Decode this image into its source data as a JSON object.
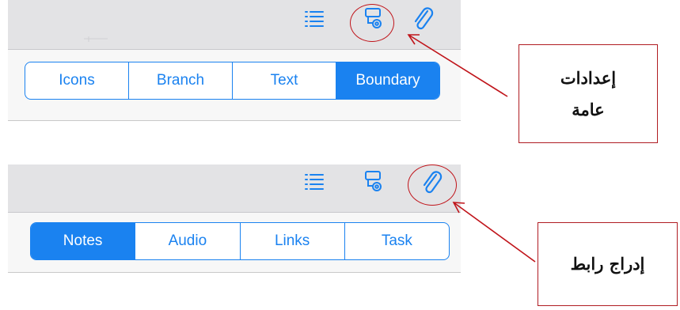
{
  "colors": {
    "accent": "#1a82f0",
    "annotation": "#c0141a"
  },
  "panels": [
    {
      "toolbar_icons": [
        "list-icon",
        "map-settings-icon",
        "paperclip-icon"
      ],
      "tabs": [
        {
          "label": "Icons",
          "active": false
        },
        {
          "label": "Branch",
          "active": false
        },
        {
          "label": "Text",
          "active": false
        },
        {
          "label": "Boundary",
          "active": true
        }
      ],
      "highlighted_icon": "map-settings-icon"
    },
    {
      "toolbar_icons": [
        "list-icon",
        "map-settings-icon",
        "paperclip-icon"
      ],
      "tabs": [
        {
          "label": "Notes",
          "active": true
        },
        {
          "label": "Audio",
          "active": false
        },
        {
          "label": "Links",
          "active": false
        },
        {
          "label": "Task",
          "active": false
        }
      ],
      "highlighted_icon": "paperclip-icon"
    }
  ],
  "callouts": [
    {
      "line1": "إعدادات",
      "line2": "عامة"
    },
    {
      "line1": "إدراج رابط"
    }
  ]
}
